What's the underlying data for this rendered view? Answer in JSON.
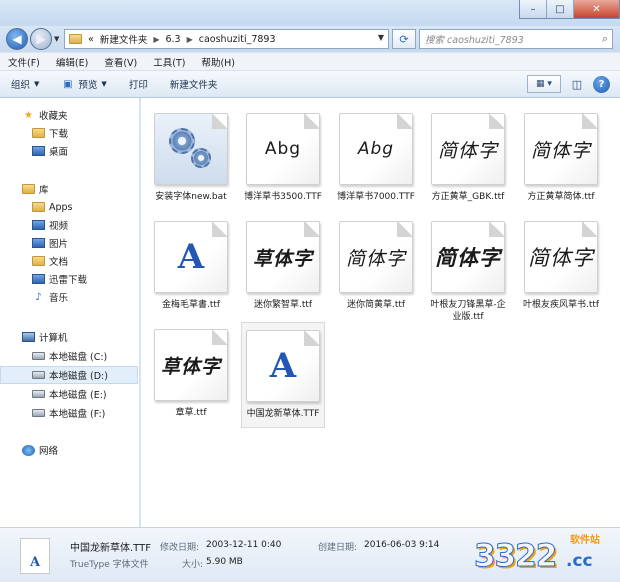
{
  "address": {
    "prefix": "«",
    "crumbs": [
      "新建文件夹",
      "6.3",
      "caoshuziti_7893"
    ],
    "search_placeholder": "搜索 caoshuziti_7893"
  },
  "menu": [
    "文件(F)",
    "编辑(E)",
    "查看(V)",
    "工具(T)",
    "帮助(H)"
  ],
  "toolbar": {
    "organize": "组织",
    "preview": "预览",
    "print": "打印",
    "new_folder": "新建文件夹"
  },
  "nav": {
    "favorites": "收藏夹",
    "downloads": "下载",
    "desktop": "桌面",
    "library": "库",
    "apps": "Apps",
    "video": "视频",
    "pictures": "图片",
    "documents": "文档",
    "thunder": "迅雷下载",
    "music": "音乐",
    "computer": "计算机",
    "drive_c": "本地磁盘 (C:)",
    "drive_d": "本地磁盘 (D:)",
    "drive_e": "本地磁盘 (E:)",
    "drive_f": "本地磁盘 (F:)",
    "network": "网络"
  },
  "files": [
    {
      "name": "安装字体new.bat"
    },
    {
      "name": "博洋草书3500.TTF",
      "preview": "Abg"
    },
    {
      "name": "博洋草书7000.TTF",
      "preview": "Abg"
    },
    {
      "name": "方正黄草_GBK.ttf",
      "preview": "简体字"
    },
    {
      "name": "方正黄草简体.ttf",
      "preview": "简体字"
    },
    {
      "name": "金梅毛草書.ttf",
      "preview": "A"
    },
    {
      "name": "迷你繁智草.ttf",
      "preview": "草体字"
    },
    {
      "name": "迷你简黄草.ttf",
      "preview": "简体字"
    },
    {
      "name": "叶根友刀锋黑草-企业版.ttf",
      "preview": "简体字"
    },
    {
      "name": "叶根友疾风草书.ttf",
      "preview": "简体字"
    },
    {
      "name": "章草.ttf",
      "preview": "草体字"
    },
    {
      "name": "中国龙新草体.TTF",
      "preview": "A"
    }
  ],
  "status": {
    "icon_letter": "A",
    "filename": "中国龙新草体.TTF",
    "filetype": "TrueType 字体文件",
    "modified_label": "修改日期:",
    "modified_value": "2003-12-11 0:40",
    "size_label": "大小:",
    "size_value": "5.90 MB",
    "created_label": "创建日期:",
    "created_value": "2016-06-03 9:14"
  },
  "watermark": {
    "number": "3322",
    "tag": "软件站",
    "suffix": ".cc"
  },
  "window_controls": {
    "minimize": "–",
    "maximize": "□",
    "close": "✕"
  }
}
